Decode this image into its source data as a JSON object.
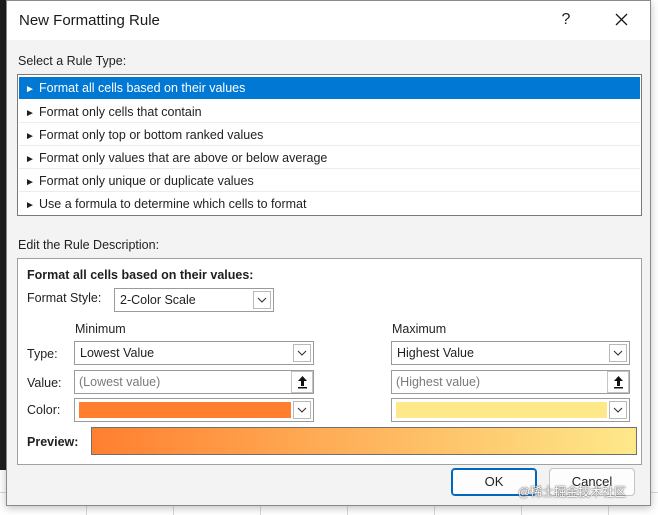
{
  "dialog": {
    "title": "New Formatting Rule",
    "help_glyph": "?",
    "select_rule_type_label": "Select a Rule Type:",
    "edit_rule_label": "Edit the Rule Description:"
  },
  "rule_types": [
    {
      "label": "Format all cells based on their values",
      "selected": true
    },
    {
      "label": "Format only cells that contain",
      "selected": false
    },
    {
      "label": "Format only top or bottom ranked values",
      "selected": false
    },
    {
      "label": "Format only values that are above or below average",
      "selected": false
    },
    {
      "label": "Format only unique or duplicate values",
      "selected": false
    },
    {
      "label": "Use a formula to determine which cells to format",
      "selected": false
    }
  ],
  "rule_arrow_glyph": "►",
  "description": {
    "heading": "Format all cells based on their values:",
    "format_style_label": "Format Style:",
    "format_style_value": "2-Color Scale",
    "type_label": "Type:",
    "value_label": "Value:",
    "color_label": "Color:",
    "preview_label": "Preview:",
    "minimum": {
      "header": "Minimum",
      "type_value": "Lowest Value",
      "value_placeholder": "(Lowest value)",
      "color": "#ff7f2f"
    },
    "maximum": {
      "header": "Maximum",
      "type_value": "Highest Value",
      "value_placeholder": "(Highest value)",
      "color": "#fee98a"
    }
  },
  "buttons": {
    "ok": "OK",
    "cancel": "Cancel"
  },
  "watermark": "@稀土掘金技术社区",
  "colors": {
    "selection": "#0078d4",
    "min_color": "#ff7f2f",
    "max_color": "#fee98a"
  }
}
